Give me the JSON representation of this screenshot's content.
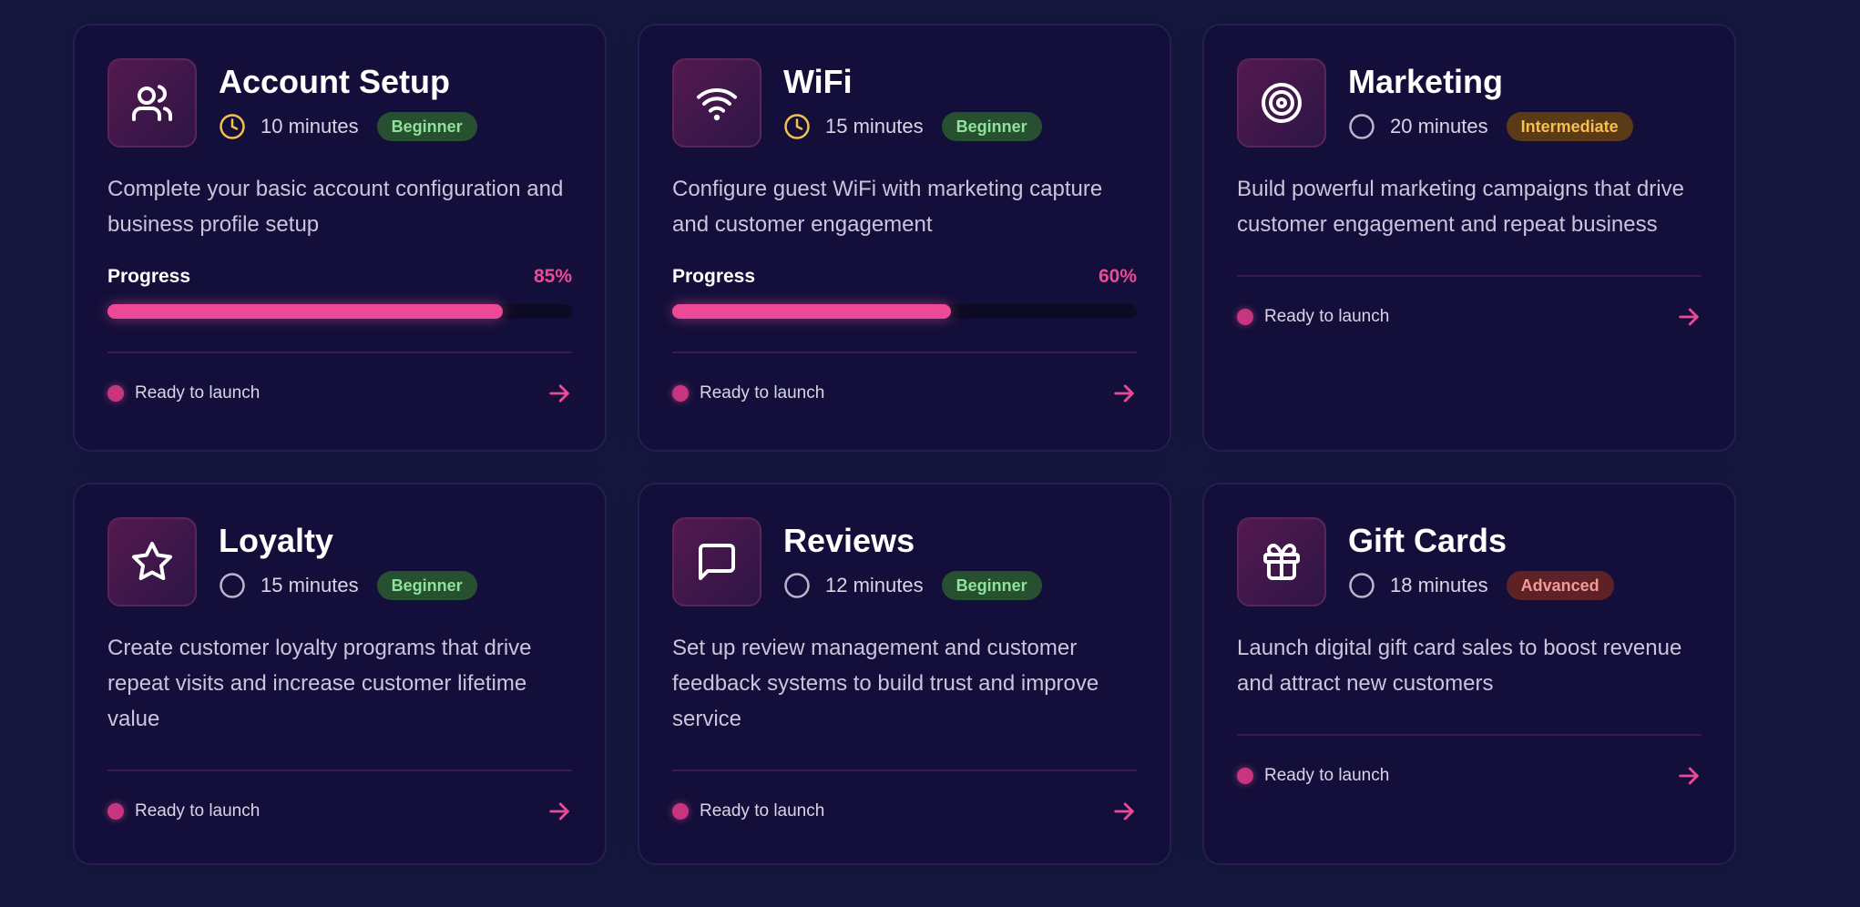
{
  "colors": {
    "background": "#16173f",
    "card": "#130f3a",
    "accent": "#ec4a97",
    "beginner": "#8fe39a",
    "intermediate": "#f4c04e",
    "advanced": "#f29a9a",
    "clock_active": "#f4c04e"
  },
  "cards": [
    {
      "title": "Account Setup",
      "icon": "users-icon",
      "time": "10 minutes",
      "clock_active": true,
      "level": "Beginner",
      "description": "Complete your basic account configuration and business profile setup",
      "progress_label": "Progress",
      "progress_pct": "85%",
      "progress_value": 0.85,
      "status": "Ready to launch"
    },
    {
      "title": "WiFi",
      "icon": "wifi-icon",
      "time": "15 minutes",
      "clock_active": true,
      "level": "Beginner",
      "description": "Configure guest WiFi with marketing capture and customer engagement",
      "progress_label": "Progress",
      "progress_pct": "60%",
      "progress_value": 0.6,
      "status": "Ready to launch"
    },
    {
      "title": "Marketing",
      "icon": "target-icon",
      "time": "20 minutes",
      "clock_active": false,
      "level": "Intermediate",
      "description": "Build powerful marketing campaigns that drive customer engagement and repeat business",
      "status": "Ready to launch"
    },
    {
      "title": "Loyalty",
      "icon": "star-icon",
      "time": "15 minutes",
      "clock_active": false,
      "level": "Beginner",
      "description": "Create customer loyalty programs that drive repeat visits and increase customer lifetime value",
      "status": "Ready to launch"
    },
    {
      "title": "Reviews",
      "icon": "message-square-icon",
      "time": "12 minutes",
      "clock_active": false,
      "level": "Beginner",
      "description": "Set up review management and customer feedback systems to build trust and improve service",
      "status": "Ready to launch"
    },
    {
      "title": "Gift Cards",
      "icon": "gift-icon",
      "time": "18 minutes",
      "clock_active": false,
      "level": "Advanced",
      "description": "Launch digital gift card sales to boost revenue and attract new customers",
      "status": "Ready to launch"
    }
  ]
}
